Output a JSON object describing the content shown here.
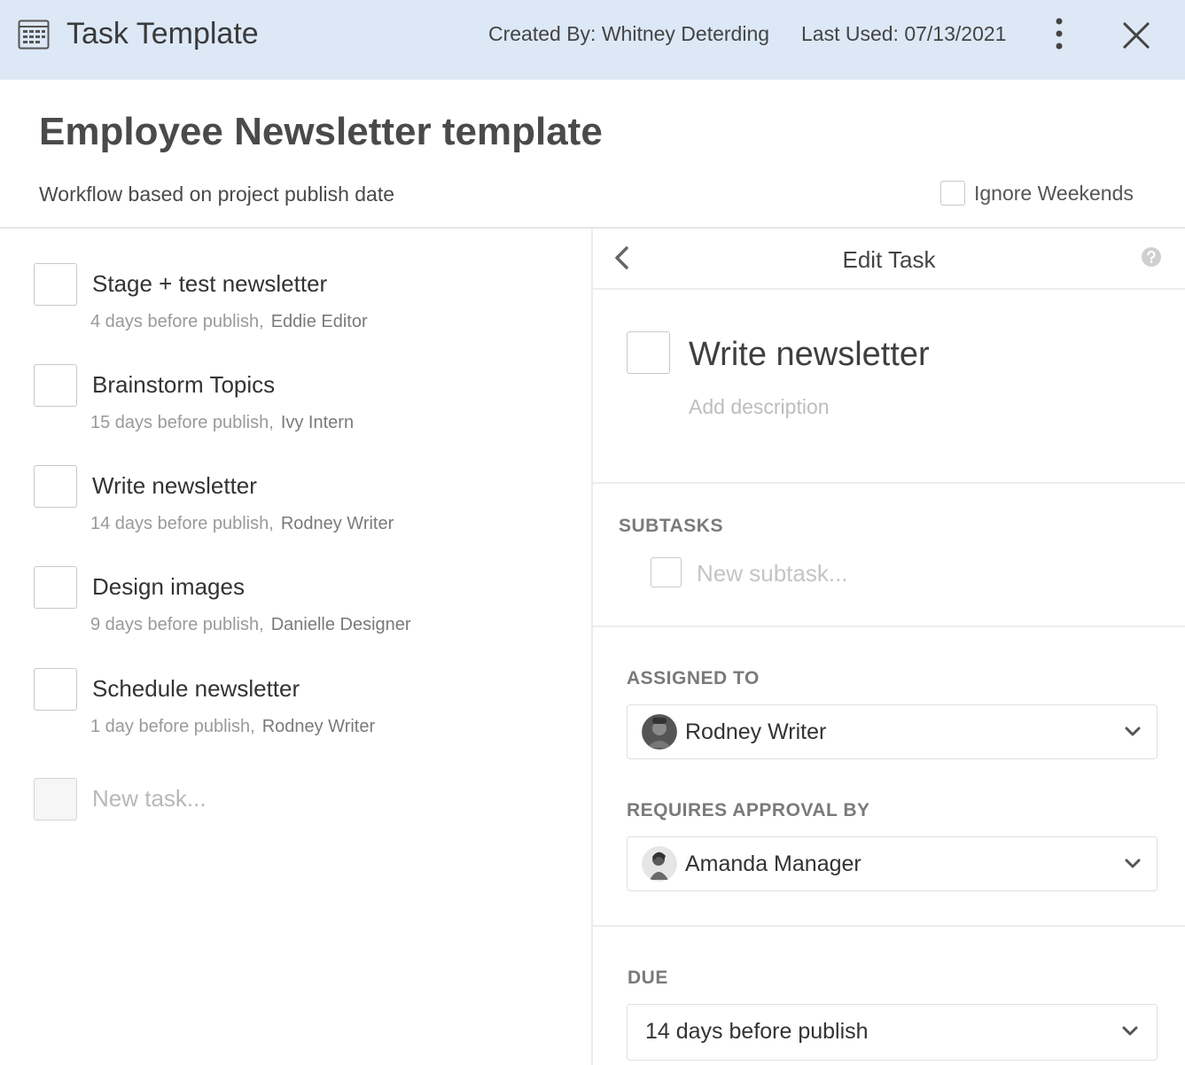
{
  "titlebar": {
    "app_icon": "template-grid-icon",
    "title": "Task Template",
    "created_by": "Created By: Whitney Deterding",
    "last_used": "Last Used: 07/13/2021",
    "more_icon": "vertical-dots-icon",
    "close_icon": "close-icon"
  },
  "header": {
    "title": "Employee Newsletter template",
    "subtitle": "Workflow based on project publish date",
    "ignore_weekends_label": "Ignore Weekends"
  },
  "tasks": [
    {
      "name": "Stage + test newsletter",
      "timing": "4 days before publish,",
      "assignee": "Eddie Editor"
    },
    {
      "name": "Brainstorm Topics",
      "timing": "15 days before publish,",
      "assignee": "Ivy Intern"
    },
    {
      "name": "Write newsletter",
      "timing": "14 days before publish,",
      "assignee": "Rodney Writer"
    },
    {
      "name": "Design images",
      "timing": "9 days before publish,",
      "assignee": "Danielle Designer"
    },
    {
      "name": "Schedule newsletter",
      "timing": "1 day before publish,",
      "assignee": "Rodney Writer"
    }
  ],
  "new_task_placeholder": "New task...",
  "edit_panel": {
    "title": "Edit Task",
    "back_icon": "chevron-left-icon",
    "help_icon": "question-circle-icon",
    "task_name": "Write newsletter",
    "description_placeholder": "Add description",
    "subtasks_label": "SUBTASKS",
    "new_subtask_placeholder": "New subtask...",
    "assigned_to_label": "ASSIGNED TO",
    "assigned_to_value": "Rodney Writer",
    "approval_label": "REQUIRES APPROVAL BY",
    "approval_value": "Amanda Manager",
    "due_label": "DUE",
    "due_value": "14 days before publish",
    "dropdown_icon": "chevron-down-icon"
  },
  "colors": {
    "titlebar_bg": "#dde8f7",
    "text_primary": "#333333",
    "text_muted": "#9a9a9a",
    "border": "#c8c8c8"
  }
}
